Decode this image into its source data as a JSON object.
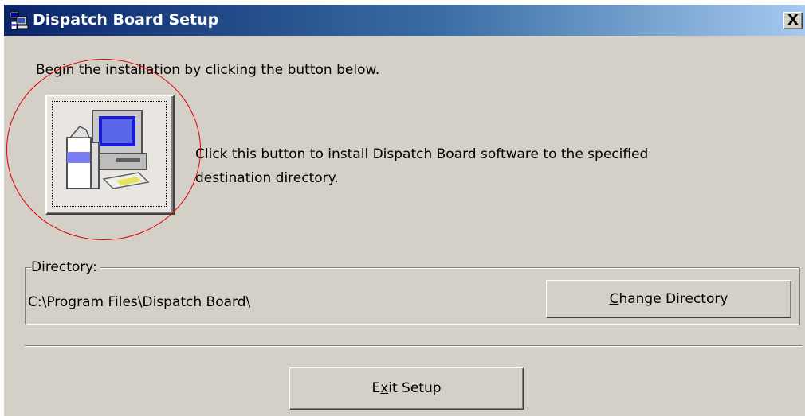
{
  "window": {
    "title": "Dispatch Board Setup",
    "close_label": "X"
  },
  "main": {
    "intro_text": "Begin the installation by clicking the button below.",
    "install_button_description": "Click this button to install Dispatch Board software to the specified destination directory.",
    "install_button_icon": "computer-install-icon"
  },
  "directory": {
    "group_label": "Directory:",
    "path": "C:\\Program Files\\Dispatch Board\\",
    "change_button": {
      "pre": "",
      "mnemonic": "C",
      "post": "hange Directory"
    }
  },
  "footer": {
    "exit_button": {
      "pre": "E",
      "mnemonic": "x",
      "post": "it Setup"
    }
  },
  "colors": {
    "window_bg": "#d4d0c8",
    "title_gradient_start": "#0a246a",
    "title_gradient_end": "#a6caf0",
    "annotation_circle": "#e00000"
  }
}
